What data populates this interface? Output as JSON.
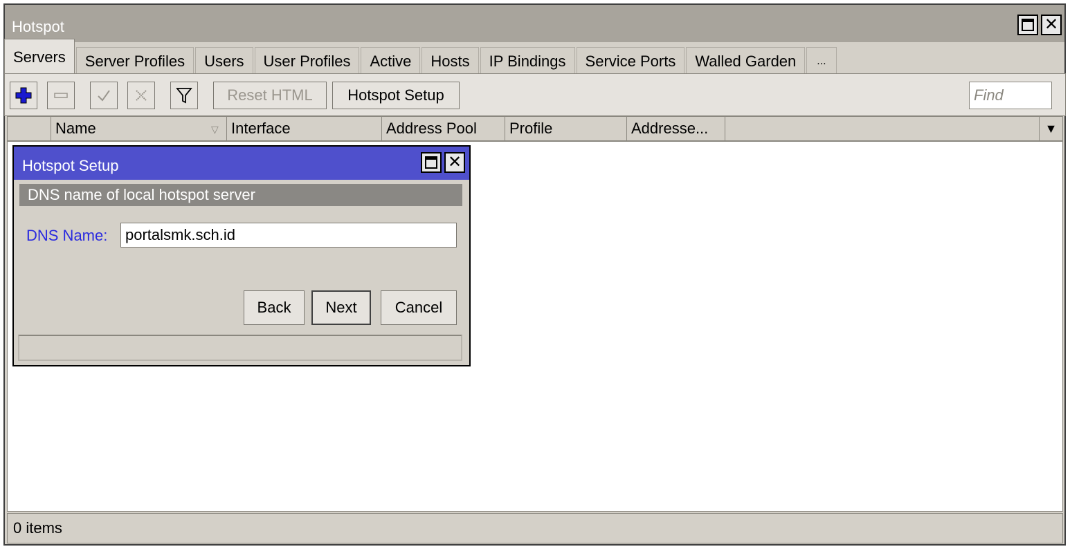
{
  "window": {
    "title": "Hotspot"
  },
  "tabs": [
    {
      "label": "Servers",
      "active": true
    },
    {
      "label": "Server Profiles"
    },
    {
      "label": "Users"
    },
    {
      "label": "User Profiles"
    },
    {
      "label": "Active"
    },
    {
      "label": "Hosts"
    },
    {
      "label": "IP Bindings"
    },
    {
      "label": "Service Ports"
    },
    {
      "label": "Walled Garden"
    }
  ],
  "tab_more": "...",
  "toolbar": {
    "add_icon": "plus-icon",
    "remove_icon": "minus-icon",
    "enable_icon": "check-icon",
    "disable_icon": "x-icon",
    "filter_icon": "filter-icon",
    "reset_html": "Reset HTML",
    "hotspot_setup": "Hotspot Setup",
    "find_placeholder": "Find"
  },
  "columns": [
    "Name",
    "Interface",
    "Address Pool",
    "Profile",
    "Addresse..."
  ],
  "status": {
    "items": "0 items"
  },
  "dialog": {
    "title": "Hotspot Setup",
    "section": "DNS name of local hotspot server",
    "dns_label": "DNS Name:",
    "dns_value": "portalsmk.sch.id",
    "back": "Back",
    "next": "Next",
    "cancel": "Cancel"
  },
  "colors": {
    "dialog_title": "#4f50cc",
    "label_blue": "#2a2adf",
    "add_icon": "#1a1ad0"
  }
}
